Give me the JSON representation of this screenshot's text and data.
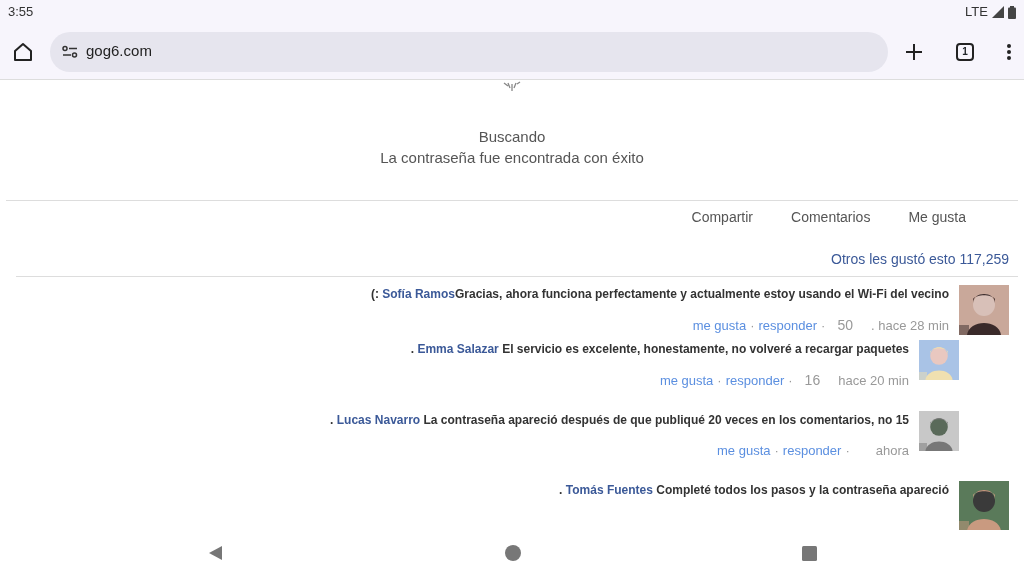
{
  "status_bar": {
    "time": "3:55",
    "network": "LTE"
  },
  "browser": {
    "url": "gog6.com",
    "tab_count": "1"
  },
  "search_status": {
    "title": "Buscando",
    "message": "La contraseña fue encontrada con éxito"
  },
  "actions": [
    "Compartir",
    "Comentarios",
    "Me gusta"
  ],
  "likes_summary": "Otros les gustó esto 117,259",
  "comments": [
    {
      "prefix": "(:",
      "author": "Sofía Ramos",
      "joined": true,
      "text": "Gracias, ahora funciona perfectamente y actualmente estoy usando el Wi-Fi del vecino",
      "like": "me gusta",
      "sep": "·",
      "reply": "responder",
      "sep2": "·",
      "count": "50",
      "time": ". hace 28 min",
      "nested": false,
      "show_actions": true
    },
    {
      "prefix": ".",
      "author": "Emma Salazar",
      "joined": false,
      "text": "El servicio es excelente, honestamente, no volveré a recargar paquetes",
      "like": "me gusta",
      "sep": "·",
      "reply": "responder",
      "sep2": "·",
      "count": "16",
      "time": "hace 20 min",
      "nested": true,
      "show_actions": true
    },
    {
      "prefix": ".",
      "author": "Lucas Navarro",
      "joined": false,
      "text": "La contraseña apareció después de que publiqué 20 veces en los comentarios, no 15",
      "like": "me gusta",
      "sep": "·",
      "reply": "responder",
      "sep2": "·",
      "time": "ahora",
      "nested": true,
      "show_actions": true
    },
    {
      "prefix": ".",
      "author": "Tomás Fuentes",
      "joined": false,
      "text": "Completé todos los pasos y la contraseña apareció",
      "nested": false,
      "show_actions": false
    }
  ]
}
